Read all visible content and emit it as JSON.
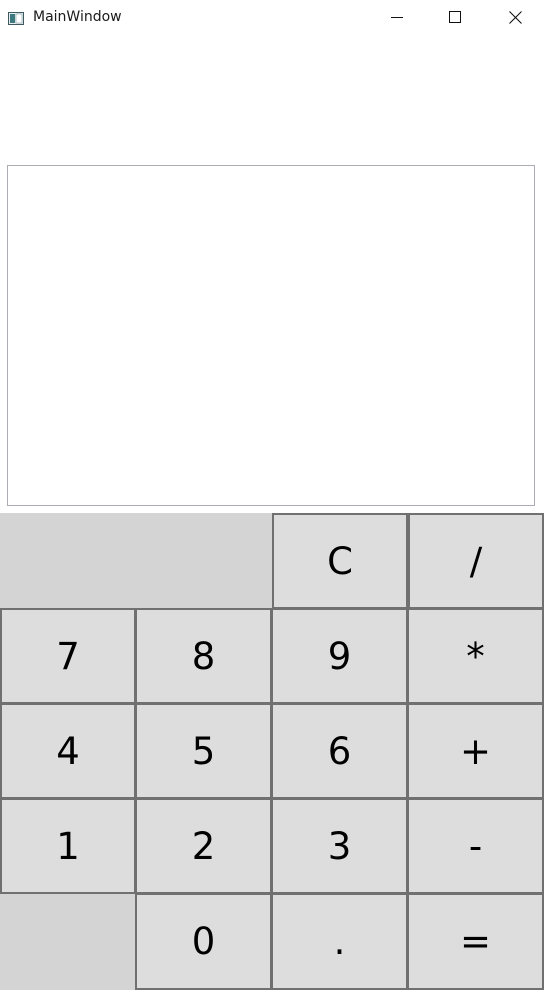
{
  "window": {
    "title": "MainWindow",
    "icon": "app-window-icon",
    "controls": {
      "minimize": "minimize-icon",
      "maximize": "maximize-icon",
      "close": "close-icon"
    }
  },
  "display": {
    "value": ""
  },
  "keys": {
    "clear": "C",
    "divide": "/",
    "seven": "7",
    "eight": "8",
    "nine": "9",
    "multiply": "*",
    "four": "4",
    "five": "5",
    "six": "6",
    "plus": "+",
    "one": "1",
    "two": "2",
    "three": "3",
    "minus": "-",
    "zero": "0",
    "decimal": ".",
    "equals": "="
  },
  "colors": {
    "key_background": "#dddddd",
    "key_border": "#707070",
    "blank_cell": "#d4d4d4",
    "display_border": "#abadb3"
  }
}
